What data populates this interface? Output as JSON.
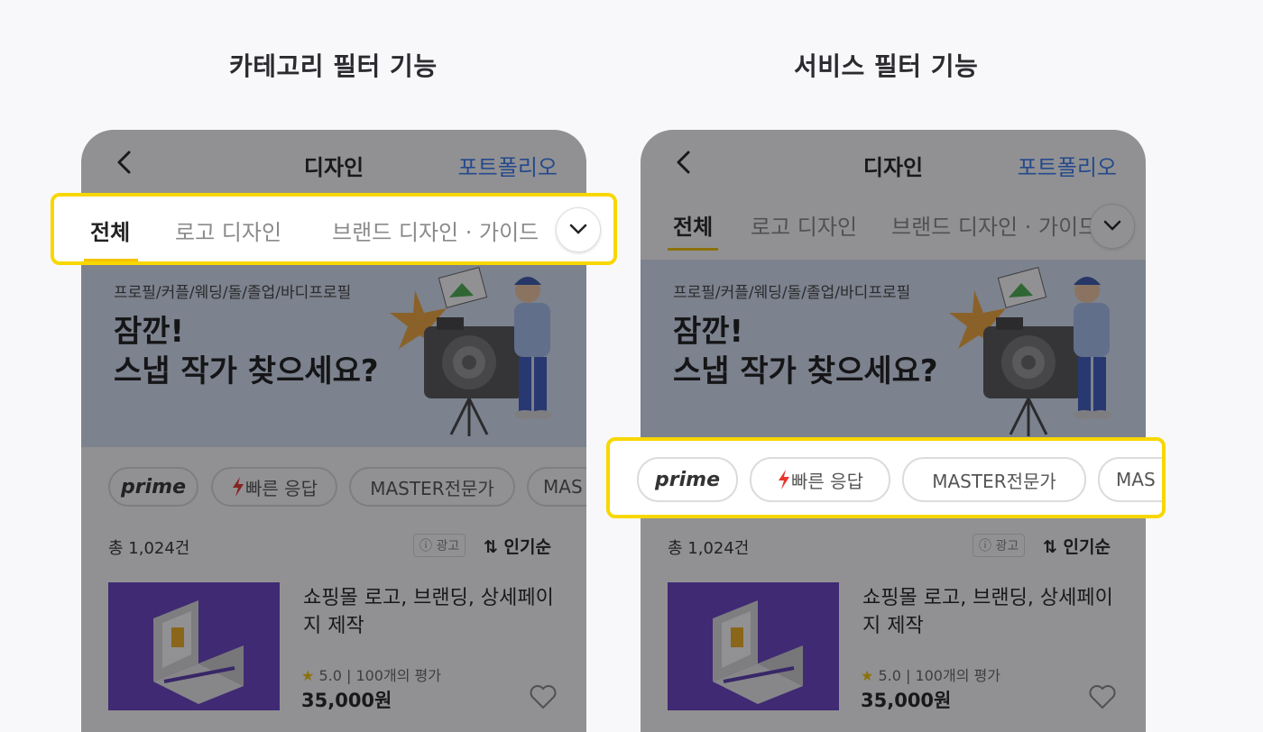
{
  "titles": {
    "left": "카테고리 필터 기능",
    "right": "서비스 필터 기능"
  },
  "screen": {
    "nav": {
      "title": "디자인",
      "link": "포트폴리오",
      "back_icon": "chevron-left-icon"
    },
    "tabs": [
      "전체",
      "로고 디자인",
      "브랜드 디자인 · 가이드"
    ],
    "more_icon": "chevron-down-icon",
    "banner": {
      "sub": "프로필/커플/웨딩/돌/졸업/바디프로필",
      "line1": "잠깐!",
      "line2": "스냅 작가 찾으세요?"
    },
    "chips": [
      "prime",
      "빠른 응답",
      "MASTER전문가",
      "MAS"
    ],
    "lightning_icon": "lightning-icon",
    "count": "총 1,024건",
    "ad_label": "광고",
    "sort_label": "인기순",
    "product": {
      "title": "쇼핑몰 로고, 브랜딩, 상세페이지 제작",
      "rating": "5.0 | 100개의 평가",
      "price": "35,000원"
    }
  },
  "colors": {
    "accent": "#3a7bf2",
    "highlight": "#f8d700",
    "tab_underline": "#f5c400",
    "thumb": "#6a42c4",
    "banner": "#d8e3f5",
    "lightning": "#e8352b"
  }
}
